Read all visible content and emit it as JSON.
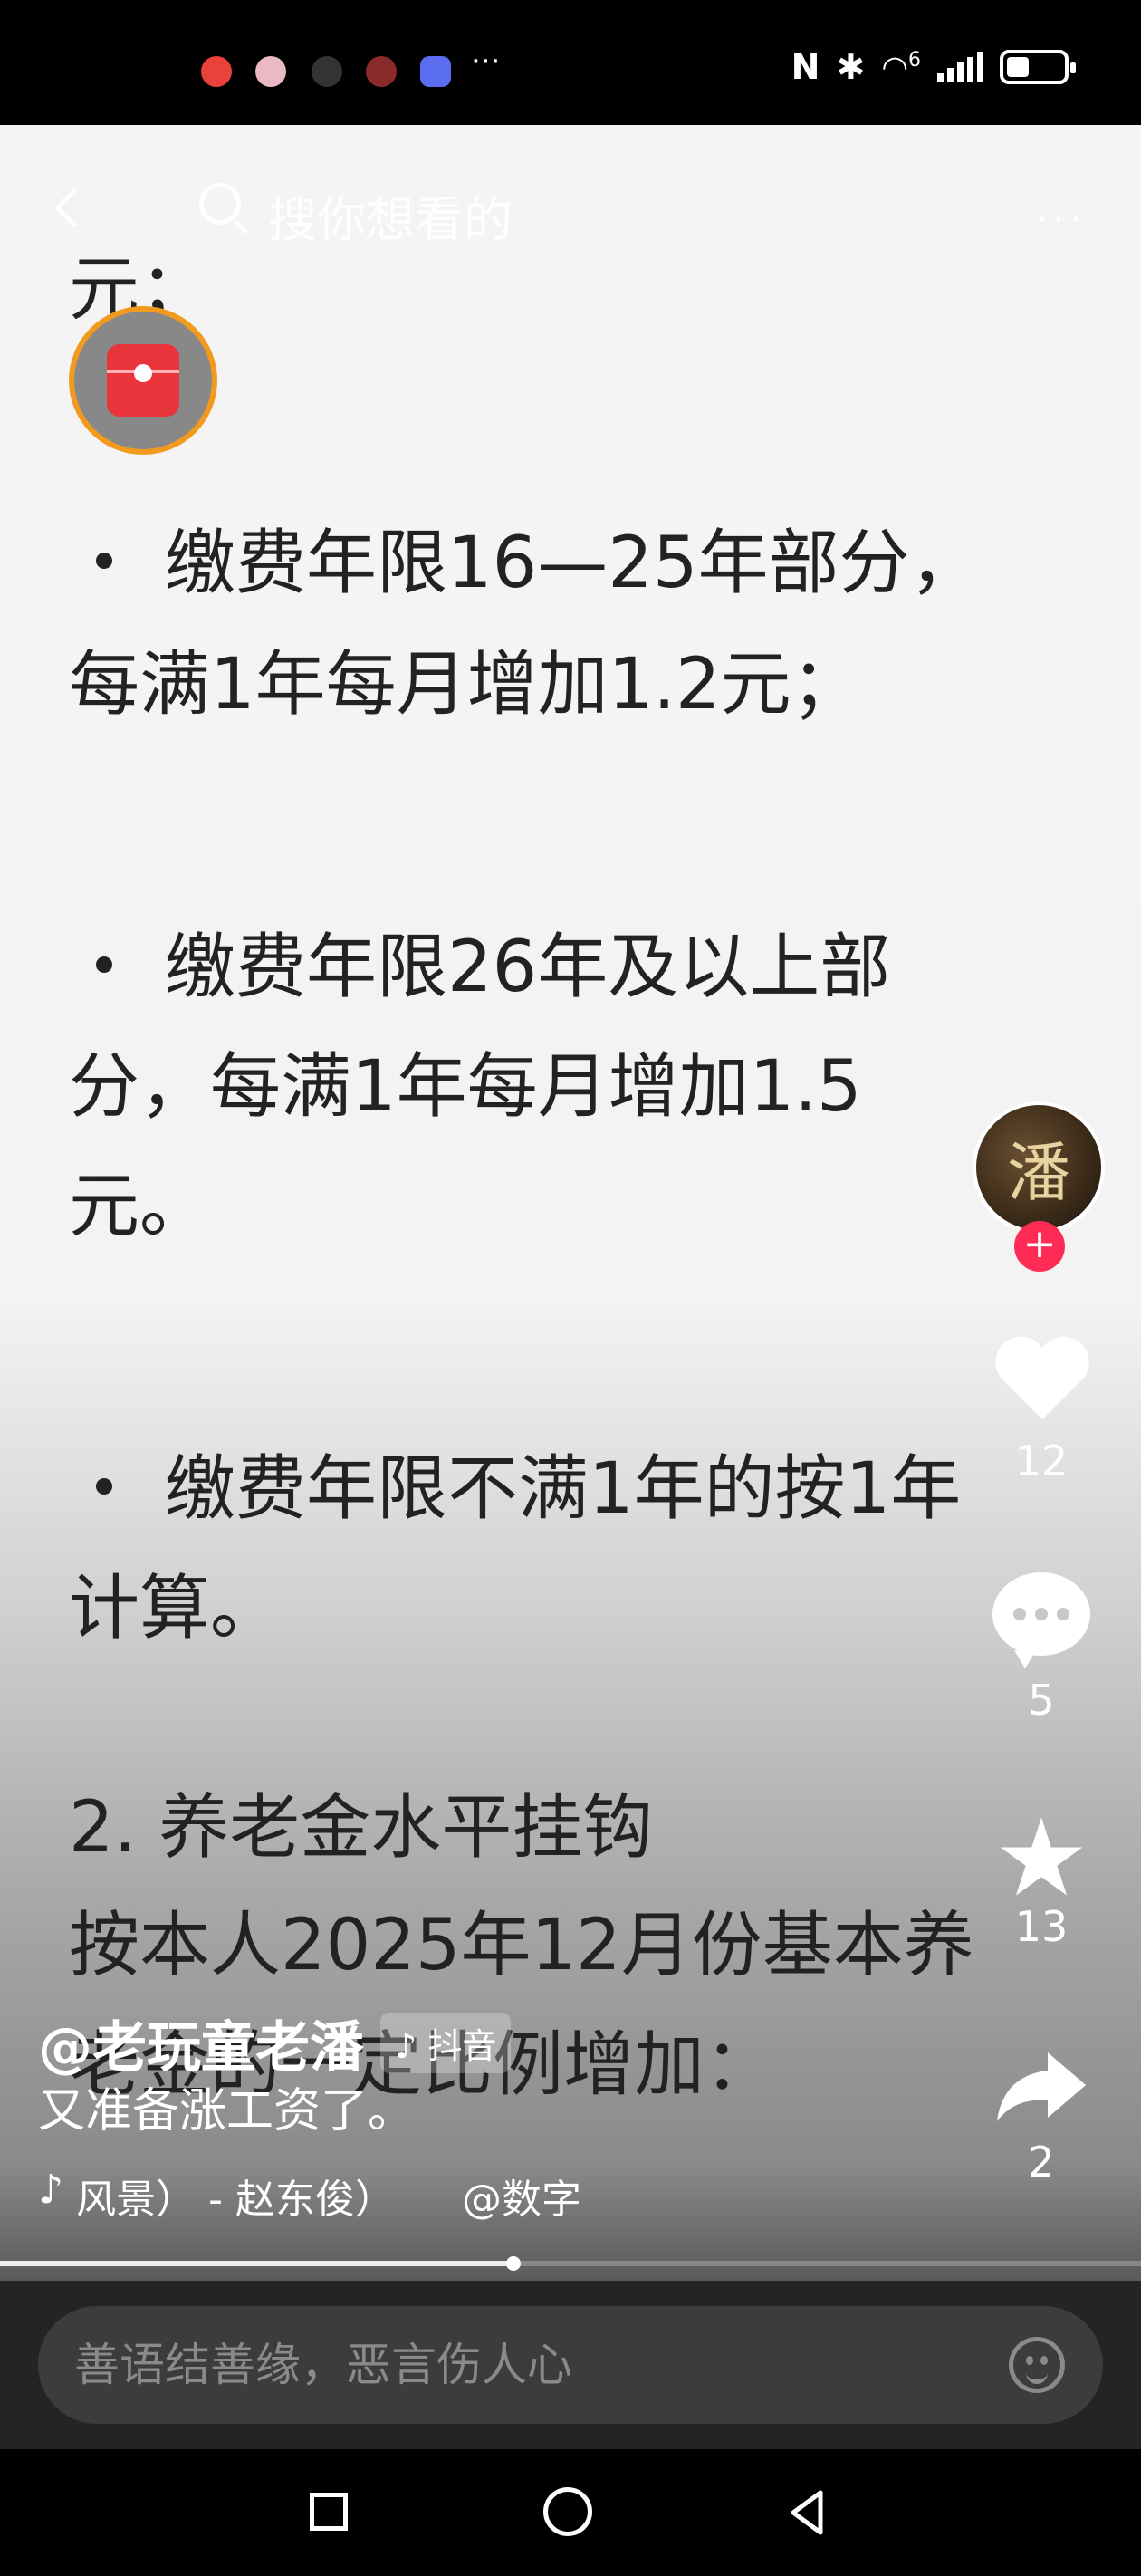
{
  "status_bar": {
    "more": "···",
    "network_label": "6",
    "battery_percent": 40
  },
  "search": {
    "placeholder": "搜你想看的",
    "more": "···"
  },
  "document": {
    "lines": [
      "元；",
      "缴费年限16—25年部分，",
      "每满1年每月增加1.2元；",
      "缴费年限26年及以上部",
      "分，每满1年每月增加1.5",
      "元。",
      "缴费年限不满1年的按1年",
      "计算。",
      "2. 养老金水平挂钩",
      "按本人2025年12月份基本养",
      "老金的一定比例增加："
    ]
  },
  "side_actions": {
    "avatar_char": "潘",
    "follow": "+",
    "like_count": "12",
    "comment_count": "5",
    "favorite_count": "13",
    "share_count": "2"
  },
  "video_info": {
    "author": "@老玩童老潘",
    "platform": "抖音",
    "caption": "又准备涨工资了。",
    "music": "风景） - 赵东俊）",
    "mention": "@数字",
    "progress_fraction": 0.45
  },
  "comment_bar": {
    "placeholder": "善语结善缘，恶言伤人心"
  }
}
